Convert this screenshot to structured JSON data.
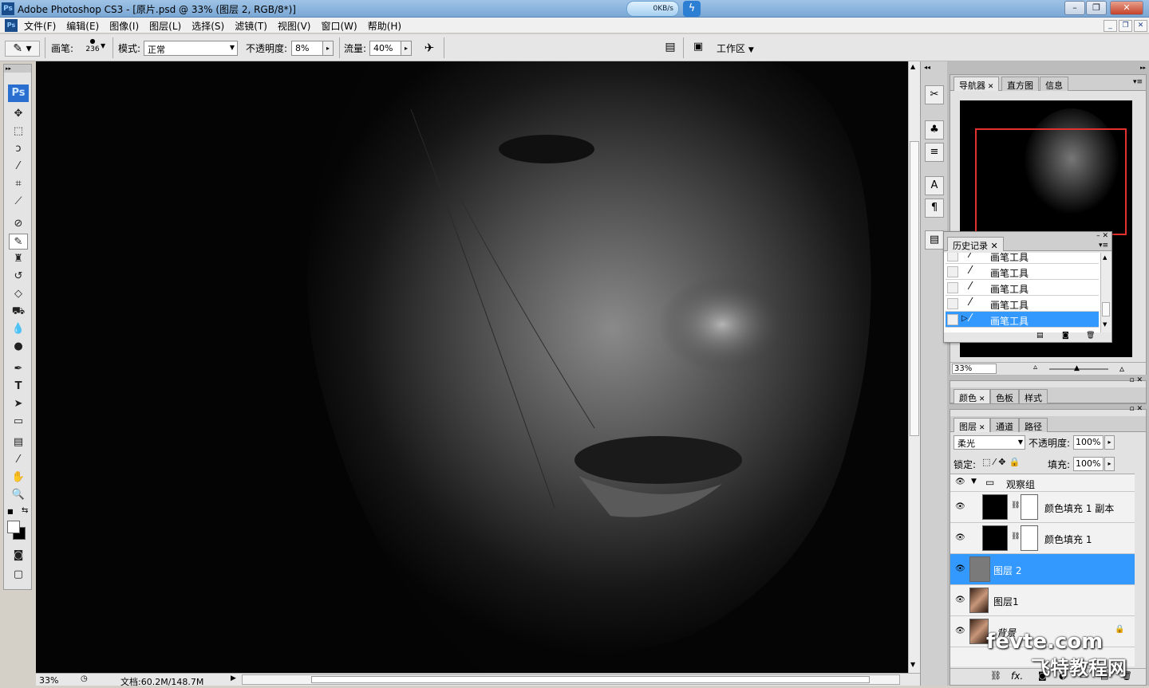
{
  "window": {
    "app_icon": "Ps",
    "title": "Adobe Photoshop CS3 - [原片.psd @ 33% (图层 2, RGB/8*)]",
    "speed": "0KB/s"
  },
  "menu": [
    "文件(F)",
    "编辑(E)",
    "图像(I)",
    "图层(L)",
    "选择(S)",
    "滤镜(T)",
    "视图(V)",
    "窗口(W)",
    "帮助(H)"
  ],
  "options": {
    "brush_label": "画笔:",
    "brush_size": "236",
    "mode_label": "模式:",
    "mode_value": "正常",
    "opacity_label": "不透明度:",
    "opacity_value": "8%",
    "flow_label": "流量:",
    "flow_value": "40%",
    "workspace_label": "工作区"
  },
  "toolbox": {
    "logo": "Ps",
    "type_tool": "T"
  },
  "status": {
    "zoom": "33%",
    "doc": "文档:60.2M/148.7M"
  },
  "navigator": {
    "tabs": [
      "导航器",
      "直方图",
      "信息"
    ],
    "zoom": "33%"
  },
  "history": {
    "tab": "历史记录",
    "items": [
      "画笔工具",
      "画笔工具",
      "画笔工具",
      "画笔工具",
      "画笔工具"
    ]
  },
  "color_panel": {
    "tabs": [
      "颜色",
      "色板",
      "样式"
    ]
  },
  "layers": {
    "tabs": [
      "图层",
      "通道",
      "路径"
    ],
    "blend_mode": "柔光",
    "opacity_label": "不透明度:",
    "opacity_value": "100%",
    "lock_label": "锁定:",
    "fill_label": "填充:",
    "fill_value": "100%",
    "group": "观察组",
    "rows": [
      "颜色填充 1 副本",
      "颜色填充 1",
      "图层 2",
      "图层1",
      "背景"
    ],
    "footer_fx": "fx."
  },
  "watermark": {
    "line1": "fevte.com",
    "line2": "飞特教程网"
  },
  "colors": {
    "selection": "#3399ff",
    "title_gradient_top": "#9fc3e6"
  }
}
